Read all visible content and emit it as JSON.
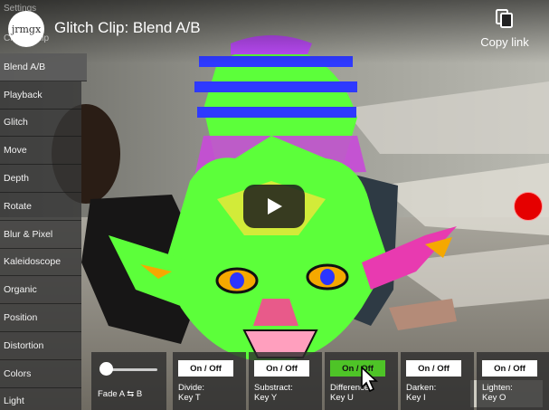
{
  "header": {
    "avatar_text": "jrmgx",
    "title": "Glitch Clip: Blend A/B",
    "copy_link_label": "Copy link"
  },
  "menu": {
    "settings_label": "Settings",
    "header_label": "Create Clip",
    "items": [
      {
        "label": "Blend A/B",
        "active": true
      },
      {
        "label": "Playback"
      },
      {
        "label": "Glitch"
      },
      {
        "label": "Move"
      },
      {
        "label": "Depth"
      },
      {
        "label": "Rotate"
      },
      {
        "label": "Blur & Pixel"
      },
      {
        "label": "Kaleidoscope"
      },
      {
        "label": "Organic"
      },
      {
        "label": "Position"
      },
      {
        "label": "Distortion"
      },
      {
        "label": "Colors"
      },
      {
        "label": "Light"
      }
    ]
  },
  "controls": {
    "fade_label": "Fade A ⇆ B",
    "fade_value": 0,
    "blends": [
      {
        "toggle": "On / Off",
        "name": "Divide:",
        "key": "Key T",
        "on": false
      },
      {
        "toggle": "On / Off",
        "name": "Substract:",
        "key": "Key Y",
        "on": false
      },
      {
        "toggle": "On / Off",
        "name": "Difference:",
        "key": "Key U",
        "on": true
      },
      {
        "toggle": "On / Off",
        "name": "Darken:",
        "key": "Key I",
        "on": false
      },
      {
        "toggle": "On / Off",
        "name": "Lighten:",
        "key": "Key O",
        "on": false
      }
    ]
  },
  "icons": {
    "copy": "copy-icon",
    "play": "play-icon",
    "record": "record-icon",
    "cursor": "cursor-arrow-icon"
  },
  "colors": {
    "record": "#e50000",
    "toggle_on": "#4ec427"
  }
}
